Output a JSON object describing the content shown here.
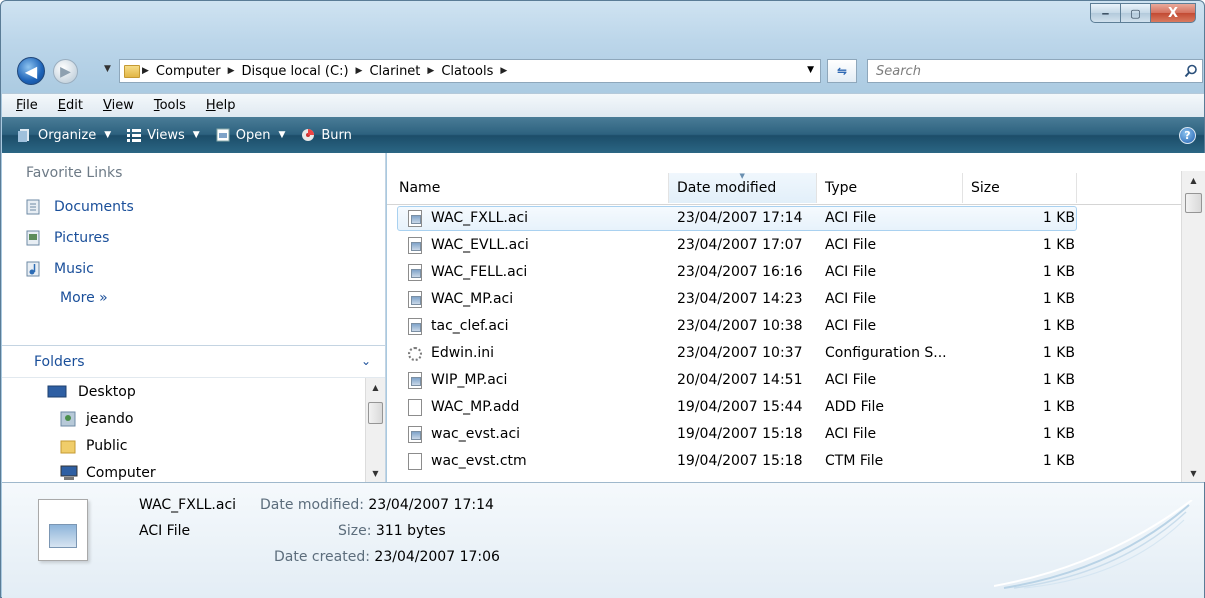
{
  "window": {
    "minimize_label": "‒",
    "maximize_label": "▢",
    "close_label": "X"
  },
  "address": {
    "crumbs": [
      "Computer",
      "Disque local (C:)",
      "Clarinet",
      "Clatools"
    ]
  },
  "search": {
    "placeholder": "Search"
  },
  "menubar": {
    "items": [
      {
        "label": "File",
        "u": "F",
        "rest": "ile"
      },
      {
        "label": "Edit",
        "u": "E",
        "rest": "dit"
      },
      {
        "label": "View",
        "u": "V",
        "rest": "iew"
      },
      {
        "label": "Tools",
        "u": "T",
        "rest": "ools"
      },
      {
        "label": "Help",
        "u": "H",
        "rest": "elp"
      }
    ]
  },
  "commandbar": {
    "organize": "Organize",
    "views": "Views",
    "open": "Open",
    "burn": "Burn",
    "help": "?"
  },
  "left": {
    "favorites_header": "Favorite Links",
    "favorites": [
      "Documents",
      "Pictures",
      "Music"
    ],
    "more": "More",
    "more_glyph": "»",
    "folders_header": "Folders",
    "tree": [
      {
        "label": "Desktop",
        "icon": "desktop-icon"
      },
      {
        "label": "jeando",
        "icon": "user-folder-icon"
      },
      {
        "label": "Public",
        "icon": "folder-icon"
      },
      {
        "label": "Computer",
        "icon": "computer-icon"
      }
    ]
  },
  "list": {
    "columns": [
      "Name",
      "Date modified",
      "Type",
      "Size"
    ],
    "sorted_column": "Date modified",
    "rows": [
      {
        "name": "WAC_FXLL.aci",
        "date": "23/04/2007 17:14",
        "type": "ACI File",
        "size": "1 KB",
        "icon": "aci"
      },
      {
        "name": "WAC_EVLL.aci",
        "date": "23/04/2007 17:07",
        "type": "ACI File",
        "size": "1 KB",
        "icon": "aci"
      },
      {
        "name": "WAC_FELL.aci",
        "date": "23/04/2007 16:16",
        "type": "ACI File",
        "size": "1 KB",
        "icon": "aci"
      },
      {
        "name": "WAC_MP.aci",
        "date": "23/04/2007 14:23",
        "type": "ACI File",
        "size": "1 KB",
        "icon": "aci"
      },
      {
        "name": "tac_clef.aci",
        "date": "23/04/2007 10:38",
        "type": "ACI File",
        "size": "1 KB",
        "icon": "aci"
      },
      {
        "name": "Edwin.ini",
        "date": "23/04/2007 10:37",
        "type": "Configuration S...",
        "size": "1 KB",
        "icon": "gear"
      },
      {
        "name": "WIP_MP.aci",
        "date": "20/04/2007 14:51",
        "type": "ACI File",
        "size": "1 KB",
        "icon": "aci"
      },
      {
        "name": "WAC_MP.add",
        "date": "19/04/2007 15:44",
        "type": "ADD File",
        "size": "1 KB",
        "icon": "blank"
      },
      {
        "name": "wac_evst.aci",
        "date": "19/04/2007 15:18",
        "type": "ACI File",
        "size": "1 KB",
        "icon": "aci"
      },
      {
        "name": "wac_evst.ctm",
        "date": "19/04/2007 15:18",
        "type": "CTM File",
        "size": "1 KB",
        "icon": "blank"
      }
    ]
  },
  "details": {
    "name": "WAC_FXLL.aci",
    "type": "ACI File",
    "date_modified_label": "Date modified:",
    "date_modified": "23/04/2007 17:14",
    "size_label": "Size:",
    "size": "311 bytes",
    "date_created_label": "Date created:",
    "date_created": "23/04/2007 17:06"
  }
}
